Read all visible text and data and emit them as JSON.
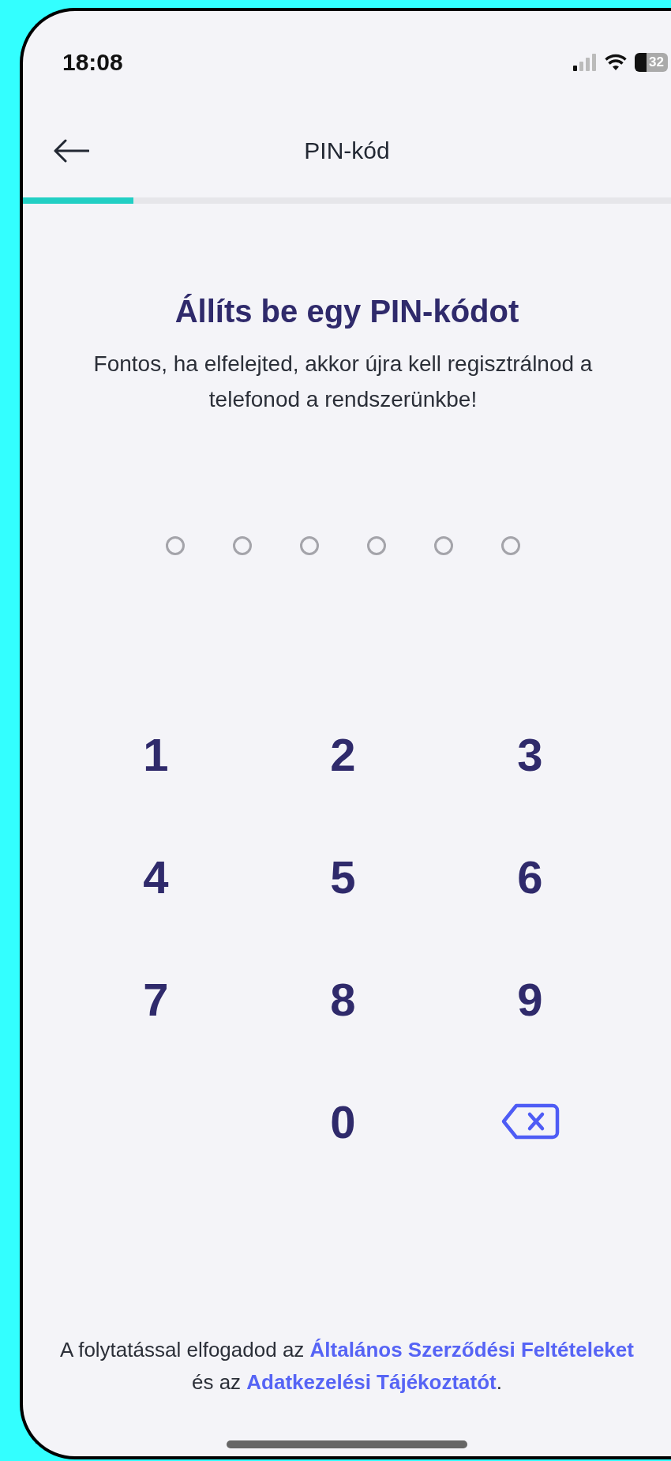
{
  "status_bar": {
    "time": "18:08",
    "battery": "32"
  },
  "header": {
    "title": "PIN-kód"
  },
  "progress": {
    "level": 0.17
  },
  "heading": "Állíts be egy PIN-kódot",
  "subtitle": "Fontos, ha elfelejted, akkor újra kell regisztrálnod a telefonod a rendszerünkbe!",
  "pin_dots": [
    {
      "filled": false
    },
    {
      "filled": false
    },
    {
      "filled": false
    },
    {
      "filled": false
    },
    {
      "filled": false
    },
    {
      "filled": false
    }
  ],
  "keypad": [
    {
      "kind": "digit",
      "label": "1"
    },
    {
      "kind": "digit",
      "label": "2"
    },
    {
      "kind": "digit",
      "label": "3"
    },
    {
      "kind": "digit",
      "label": "4"
    },
    {
      "kind": "digit",
      "label": "5"
    },
    {
      "kind": "digit",
      "label": "6"
    },
    {
      "kind": "digit",
      "label": "7"
    },
    {
      "kind": "digit",
      "label": "8"
    },
    {
      "kind": "digit",
      "label": "9"
    },
    {
      "kind": "empty"
    },
    {
      "kind": "digit",
      "label": "0"
    },
    {
      "kind": "backspace"
    }
  ],
  "footer": [
    {
      "kind": "text",
      "text": "A folytatással elfogadod az "
    },
    {
      "kind": "link",
      "text": "Általános Szerződési Feltételeket"
    },
    {
      "kind": "text",
      "text": " és az "
    },
    {
      "kind": "link",
      "text": "Adatkezelési Tájékoztatót"
    },
    {
      "kind": "text",
      "text": "."
    }
  ]
}
